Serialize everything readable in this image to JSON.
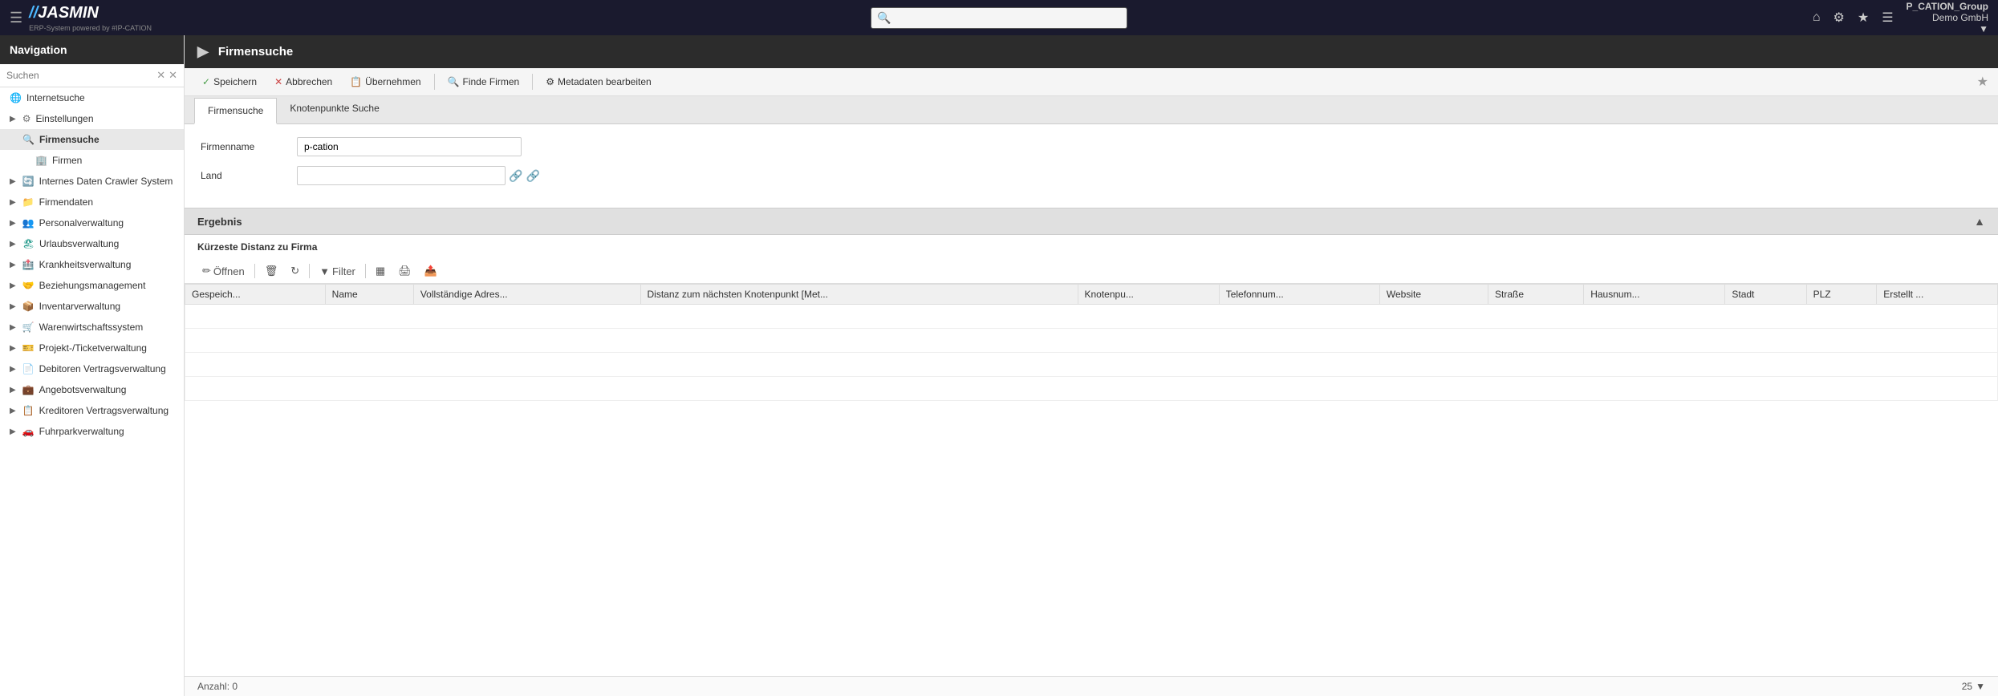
{
  "header": {
    "menu_icon": "☰",
    "logo_slashes": "//",
    "logo_name": "JASMIN",
    "logo_subtitle": "ERP-System powered by #IP-CATION",
    "search_placeholder": "",
    "icons": [
      "⌂",
      "⚙",
      "★",
      "☰"
    ],
    "user": {
      "company": "P_CATION_Group",
      "name": "Demo GmbH",
      "arrow": "▼"
    }
  },
  "sidebar": {
    "title": "Navigation",
    "search_placeholder": "Suchen",
    "items": [
      {
        "label": "Internetsuche",
        "icon": "🌐",
        "level": 0,
        "arrow": "▶",
        "has_arrow": false
      },
      {
        "label": "Einstellungen",
        "icon": "⚙",
        "level": 0,
        "arrow": "▶",
        "has_arrow": true
      },
      {
        "label": "Firmensuche",
        "icon": "🔍",
        "level": 1,
        "arrow": "",
        "has_arrow": false,
        "active": true
      },
      {
        "label": "Firmen",
        "icon": "🏢",
        "level": 2,
        "arrow": "",
        "has_arrow": false
      },
      {
        "label": "Internes Daten Crawler System",
        "icon": "🔄",
        "level": 0,
        "arrow": "▶",
        "has_arrow": true
      },
      {
        "label": "Firmendaten",
        "icon": "📁",
        "level": 0,
        "arrow": "▶",
        "has_arrow": true
      },
      {
        "label": "Personalverwaltung",
        "icon": "👥",
        "level": 0,
        "arrow": "▶",
        "has_arrow": true
      },
      {
        "label": "Urlaubsverwaltung",
        "icon": "🏖",
        "level": 0,
        "arrow": "▶",
        "has_arrow": true
      },
      {
        "label": "Krankheitsverwaltung",
        "icon": "🏥",
        "level": 0,
        "arrow": "▶",
        "has_arrow": true
      },
      {
        "label": "Beziehungsmanagement",
        "icon": "🤝",
        "level": 0,
        "arrow": "▶",
        "has_arrow": true
      },
      {
        "label": "Inventarverwaltung",
        "icon": "📦",
        "level": 0,
        "arrow": "▶",
        "has_arrow": true
      },
      {
        "label": "Warenwirtschaftssystem",
        "icon": "🛒",
        "level": 0,
        "arrow": "▶",
        "has_arrow": true
      },
      {
        "label": "Projekt-/Ticketverwaltung",
        "icon": "🎫",
        "level": 0,
        "arrow": "▶",
        "has_arrow": true
      },
      {
        "label": "Debitoren Vertragsverwaltung",
        "icon": "📄",
        "level": 0,
        "arrow": "▶",
        "has_arrow": true
      },
      {
        "label": "Angebotsverwaltung",
        "icon": "💼",
        "level": 0,
        "arrow": "▶",
        "has_arrow": true
      },
      {
        "label": "Kreditoren Vertragsverwaltung",
        "icon": "📋",
        "level": 0,
        "arrow": "▶",
        "has_arrow": true
      },
      {
        "label": "Fuhrparkverwaltung",
        "icon": "🚗",
        "level": 0,
        "arrow": "▶",
        "has_arrow": true
      }
    ]
  },
  "page": {
    "title": "Firmensuche",
    "title_arrow": "▶",
    "star_btn": "★"
  },
  "toolbar": {
    "buttons": [
      {
        "id": "save",
        "label": "Speichern",
        "icon": "✓",
        "icon_color": "#4a9e4a"
      },
      {
        "id": "cancel",
        "label": "Abbrechen",
        "icon": "✕",
        "icon_color": "#cc4444"
      },
      {
        "id": "apply",
        "label": "Übernehmen",
        "icon": "📋",
        "icon_color": "#555"
      },
      {
        "id": "find",
        "label": "Finde Firmen",
        "icon": "🔍",
        "icon_color": "#555"
      },
      {
        "id": "metadata",
        "label": "Metadaten bearbeiten",
        "icon": "⚙",
        "icon_color": "#555"
      }
    ]
  },
  "tabs": [
    {
      "id": "firmensuche",
      "label": "Firmensuche",
      "active": true
    },
    {
      "id": "knotenpunkte",
      "label": "Knotenpunkte Suche",
      "active": false
    }
  ],
  "form": {
    "fields": [
      {
        "id": "firmenname",
        "label": "Firmenname",
        "value": "p-cation",
        "type": "text"
      },
      {
        "id": "land",
        "label": "Land",
        "value": "",
        "type": "text"
      }
    ],
    "land_icon1": "🔗",
    "land_icon2": "🔗"
  },
  "results": {
    "section_title": "Ergebnis",
    "collapse_icon": "▲",
    "subtitle": "Kürzeste Distanz zu Firma",
    "table_toolbar": {
      "edit_icon": "✏",
      "delete_icon": "🗑",
      "refresh_icon": "↻",
      "filter_label": "Filter",
      "filter_icon": "▼",
      "grid_icon": "▦",
      "print_icon": "🖨",
      "export_icon": "📤"
    },
    "columns": [
      "Gespeich...",
      "Name",
      "Vollständige Adres...",
      "Distanz zum nächsten Knotenpunkt [Met...",
      "Knotenpu...",
      "Telefonnum...",
      "Website",
      "Straße",
      "Hausnum...",
      "Stadt",
      "PLZ",
      "Erstellt ..."
    ],
    "rows": [],
    "footer": {
      "count_label": "Anzahl:",
      "count_value": "0",
      "page_size": "25",
      "page_size_arrow": "▼"
    }
  }
}
